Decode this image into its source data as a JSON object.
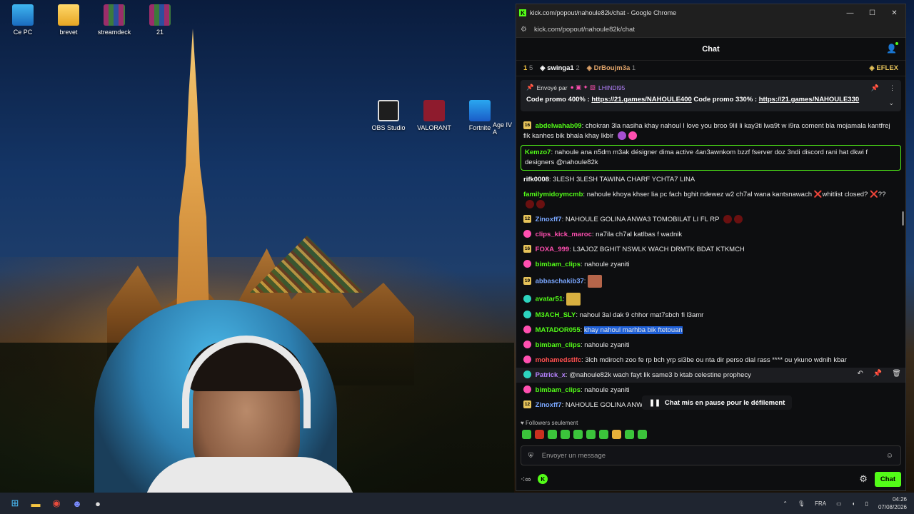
{
  "desktop": {
    "icons": [
      {
        "label": "Ce PC"
      },
      {
        "label": "brevet"
      },
      {
        "label": "streamdeck"
      },
      {
        "label": "21"
      },
      {
        "label": "OBS Studio"
      },
      {
        "label": "VALORANT"
      },
      {
        "label": "Fortnite"
      },
      {
        "label": "Age IV A"
      }
    ]
  },
  "taskbar": {
    "lang": "FRA",
    "time": "04:26",
    "date": "07/08/2026"
  },
  "browser": {
    "title": "kick.com/popout/nahoule82k/chat - Google Chrome",
    "url": "kick.com/popout/nahoule82k/chat",
    "controls": {
      "minimize": "—",
      "maximize": "☐",
      "close": "✕"
    }
  },
  "chat": {
    "header_title": "Chat",
    "leaderboard": {
      "rank_text": "1",
      "rank_count": "5",
      "u1": "swinga1",
      "u1_count": "2",
      "u2": "DrBoujm3a",
      "u2_count": "1",
      "right": "EFLEX"
    },
    "pinned": {
      "sent_by": "Envoyé par",
      "user": "LHINDI95",
      "promo_a": "Code promo 400% : ",
      "link_a": "https://21.games/NAHOULE400",
      "promo_b": " Code promo 330% : ",
      "link_b": "https://21.games/NAHOULE330"
    },
    "messages": [
      {
        "badge": "16",
        "user": "abdelwahab09",
        "color": "#53fc18",
        "text": "chokran 3la nasiha khay nahoul I love you broo 9lil li kay3ti lwa9t w i9ra coment bla mojamala kantfrej fik kanhes bik bhala khay lkbir"
      },
      {
        "badge": "",
        "user": "Kemzo7",
        "color": "#53fc18",
        "text": "nahoule ana n5dm m3ak désigner dima active 4an3awnkom bzzf fserver doz 3ndi discord rani hat dkwi f designers @nahoule82k"
      },
      {
        "badge": "",
        "user": "rifk0008",
        "color": "#ffffff",
        "text": "3LESH 3LESH TAWINA CHARF YCHTA7 LINA"
      },
      {
        "badge": "",
        "user": "familymidoymcmb",
        "color": "#53fc18",
        "text": "nahoule khoya khser lia pc fach bghit ndewez w2 ch7al wana kantsnawach ❌whitlist closed? ❌??"
      },
      {
        "badge": "12",
        "user": "Zinoxff7",
        "color": "#7aa7ff",
        "text": "NAHOULE GOLINA ANWA3 TOMOBILAT LI FL RP"
      },
      {
        "badge": "",
        "user": "clips_kick_maroc",
        "color": "#ff4fb0",
        "text": "na7ila ch7al katlbas f wadnik"
      },
      {
        "badge": "16",
        "user": "FOXA_999",
        "color": "#ff4fb0",
        "text": "L3AJOZ BGHIT NSWLK WACH DRMTK BDAT KTKMCH"
      },
      {
        "badge": "",
        "user": "bimbam_clips",
        "color": "#53fc18",
        "text": "nahoule zyaniti"
      },
      {
        "badge": "19",
        "user": "abbaschakib37",
        "color": "#7aa7ff",
        "text": ""
      },
      {
        "badge": "",
        "user": "avatar51",
        "color": "#53fc18",
        "text": ""
      },
      {
        "badge": "",
        "user": "M3ACH_SLY",
        "color": "#53fc18",
        "text": "nahoul 3al dak 9 chhor mat7sbch fi l3amr"
      },
      {
        "badge": "",
        "user": "MATADOR055",
        "color": "#53fc18",
        "text": "khay nahoul marhba bik ftetouan"
      },
      {
        "badge": "",
        "user": "bimbam_clips",
        "color": "#53fc18",
        "text": "nahoule zyaniti"
      },
      {
        "badge": "",
        "user": "mohamedstlfc",
        "color": "#ff4f4f",
        "text": "3lch mdiroch zoo fe rp bch yrp si3be ou nta dir perso dial rass **** ou ykuno wdnih kbar"
      },
      {
        "badge": "",
        "user": "Patrick_x",
        "color": "#b682ff",
        "text": "@nahoule82k wach fayt lik same3 b ktab celestine prophecy"
      },
      {
        "badge": "",
        "user": "bimbam_clips",
        "color": "#53fc18",
        "text": "nahoule zyaniti"
      },
      {
        "badge": "12",
        "user": "Zinoxff7",
        "color": "#7aa7ff",
        "text": "NAHOULE GOLINA ANW"
      }
    ],
    "paused_text": "Chat mis en pause pour le défilement",
    "followers_only": "Followers seulement",
    "input_placeholder": "Envoyer un message",
    "send_label": "Chat"
  }
}
